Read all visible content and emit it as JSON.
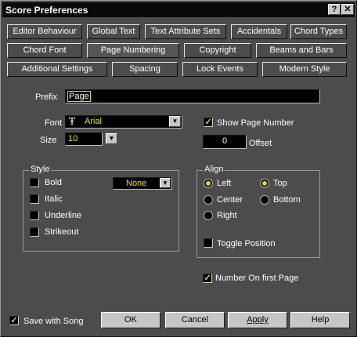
{
  "window": {
    "title": "Score Preferences",
    "help_label": "?",
    "close_label": "✕"
  },
  "tabs": {
    "row1": [
      "Editor Behaviour",
      "Global Text",
      "Text Attribute Sets",
      "Accidentals",
      "Chord Types"
    ],
    "row2": [
      "Chord Font",
      "Page Numbering",
      "Copyright",
      "Beams and Bars"
    ],
    "row3": [
      "Additional Settings",
      "Spacing",
      "Lock Events",
      "Modern Style"
    ],
    "selected": "Page Numbering"
  },
  "prefix": {
    "label": "Prefix",
    "value": "Page"
  },
  "font": {
    "label": "Font",
    "value": "Arial",
    "icon": "truetype-icon"
  },
  "size": {
    "label": "Size",
    "value": "10"
  },
  "show_page_number": {
    "label": "Show Page Number",
    "checked": true
  },
  "offset": {
    "label": "Offset",
    "value": "0"
  },
  "style": {
    "label": "Style",
    "bold": "Bold",
    "italic": "Italic",
    "underline": "Underline",
    "strikeout": "Strikeout",
    "frame_select": "None"
  },
  "align": {
    "label": "Align",
    "left": "Left",
    "center": "Center",
    "right": "Right",
    "top": "Top",
    "bottom": "Bottom",
    "toggle_position": "Toggle Position",
    "selected_h": "Left",
    "selected_v": "Top"
  },
  "number_first_page": {
    "label": "Number On first Page",
    "checked": true
  },
  "save_with_song": {
    "label": "Save with Song",
    "checked": true
  },
  "buttons": {
    "ok": "OK",
    "cancel": "Cancel",
    "apply": "Apply",
    "help": "Help"
  },
  "colors": {
    "accent": "#e8d020",
    "title_bg": "#0a0a0a",
    "panel": "#4c4c4c",
    "field": "#000000"
  }
}
